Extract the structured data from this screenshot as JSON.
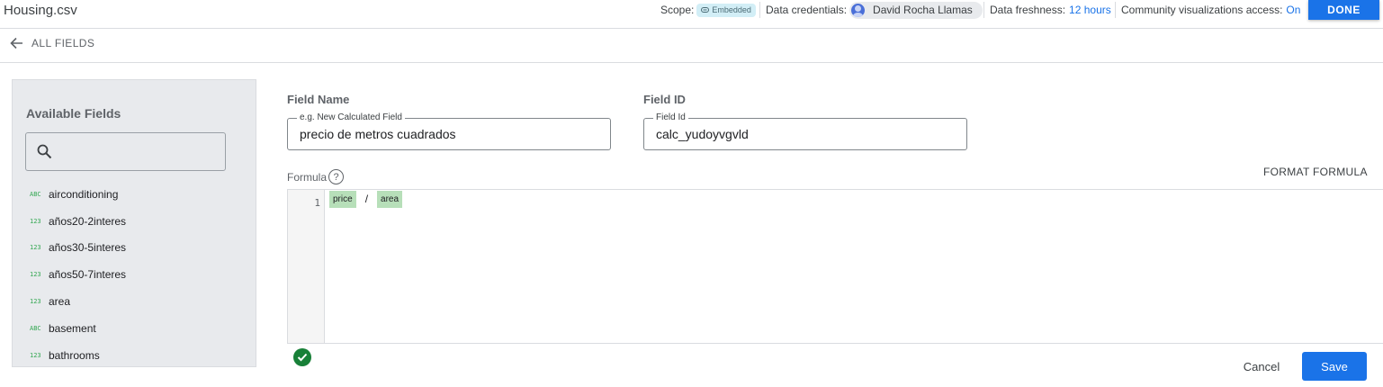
{
  "app": {
    "datasource_name": "Housing.csv"
  },
  "header": {
    "scope_label": "Scope:",
    "scope_value": "Embedded",
    "credentials_label": "Data credentials:",
    "credentials_user": "David Rocha Llamas",
    "freshness_label": "Data freshness:",
    "freshness_value": "12 hours",
    "community_label": "Community visualizations access:",
    "community_value": "On",
    "done_label": "DONE"
  },
  "nav": {
    "back_label": "ALL FIELDS"
  },
  "sidebar": {
    "title": "Available Fields",
    "search_placeholder": "",
    "fields": [
      {
        "type": "ABC",
        "name": "airconditioning"
      },
      {
        "type": "123",
        "name": "años20-2interes"
      },
      {
        "type": "123",
        "name": "años30-5interes"
      },
      {
        "type": "123",
        "name": "años50-7interes"
      },
      {
        "type": "123",
        "name": "area"
      },
      {
        "type": "ABC",
        "name": "basement"
      },
      {
        "type": "123",
        "name": "bathrooms"
      }
    ]
  },
  "form": {
    "field_name_label": "Field Name",
    "field_name_floating": "e.g. New Calculated Field",
    "field_name_value": "precio de metros cuadrados",
    "field_id_label": "Field ID",
    "field_id_floating": "Field Id",
    "field_id_value": "calc_yudoyvgvld",
    "formula_label": "Formula",
    "help_glyph": "?",
    "format_formula_label": "FORMAT FORMULA",
    "formula": {
      "line_number": "1",
      "left_token": "price",
      "operator": "/",
      "right_token": "area"
    },
    "cancel_label": "Cancel",
    "save_label": "Save"
  },
  "colors": {
    "accent": "#1a73e8",
    "valid": "#188038",
    "token_bg": "#b7dfb9",
    "type_icon": "#34a853"
  },
  "icons": [
    "back-arrow-icon",
    "link-icon",
    "avatar-icon",
    "search-icon",
    "help-icon",
    "check-circle-icon"
  ]
}
